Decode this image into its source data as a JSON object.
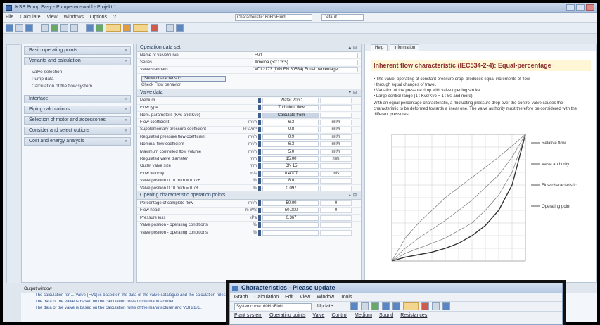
{
  "window": {
    "title": "KSB Pump Easy - Pumpenauswahl - Projekt 1"
  },
  "menu": [
    "File",
    "Calculate",
    "View",
    "Windows",
    "Options",
    "?"
  ],
  "toolbar": {
    "combo1": "Characteristic: 60Hz/Fluid",
    "combo2": "Default"
  },
  "sidebar": {
    "groups": [
      {
        "label": "Basic operating points"
      },
      {
        "label": "Variants and calculation"
      },
      {
        "label": "Interface"
      },
      {
        "label": "Piping calculations"
      },
      {
        "label": "Selection of motor and accessories"
      },
      {
        "label": "Consider and select options"
      },
      {
        "label": "Cost and energy analysis"
      }
    ],
    "subitems": [
      "Valve selection",
      "Pump data",
      "Calculation of the flow system"
    ]
  },
  "center": {
    "section1": "Operation data set",
    "fields1": [
      {
        "label": "Name of valve/curve",
        "value": "FV1"
      },
      {
        "label": "Series",
        "value": "Ameloa (50:1:3:5)"
      },
      {
        "label": "Valve standard",
        "value": "VDI 2173 (DIN EN 60534) Equal percentage"
      }
    ],
    "btn": "Show characteristic",
    "btn_text": "Check Flow behavior",
    "section2": "Valve data",
    "rows": [
      {
        "label": "Medium",
        "unit": "",
        "value": "Water 20°C",
        "extra": ""
      },
      {
        "label": "Flow type",
        "unit": "",
        "value": "Turbulent flow",
        "extra": ""
      },
      {
        "label": "Nom. parameters (Kvs and Kvo)",
        "unit": "",
        "value": "Calculate from",
        "extra": "",
        "hl": true
      },
      {
        "label": "Flow coefficient",
        "unit": "m³/h",
        "value": "6.3",
        "extra": "m³/h"
      },
      {
        "label": "Supplementary pressure coefficient",
        "unit": "kPa/m³",
        "value": "0.8",
        "extra": "m³/h"
      },
      {
        "label": "Regulated pressure flow coefficient",
        "unit": "m³/h",
        "value": "0.9",
        "extra": "m³/h"
      },
      {
        "label": "Nominal flow coefficient",
        "unit": "m³/h",
        "value": "6.3",
        "extra": "m³/h"
      },
      {
        "label": "Maximum controlled flow volume",
        "unit": "m³/h",
        "value": "5.0",
        "extra": "m³/h"
      },
      {
        "label": "Regulated valve diameter",
        "unit": "mm",
        "value": "15.00",
        "extra": "mm"
      },
      {
        "label": "Outlet valve size",
        "unit": "mm",
        "value": "DN 15",
        "extra": ""
      },
      {
        "label": "Flow velocity",
        "unit": "m/s",
        "value": "0.4007",
        "extra": "m/s"
      },
      {
        "label": "Valve position 0.10 m³/h = 0.776",
        "unit": "%",
        "value": "8.0",
        "extra": ""
      },
      {
        "label": "Valve position 0.10 m³/h = 0.78",
        "unit": "%",
        "value": "0.097",
        "extra": ""
      }
    ],
    "section3": "Opening characteristic operation points",
    "rows3": [
      {
        "label": "Percentage of complete flow",
        "unit": "m³/h",
        "value": "50.00",
        "extra": "0"
      },
      {
        "label": "Flow head",
        "unit": "m WS",
        "value": "50.000",
        "extra": "0"
      },
      {
        "label": "Pressure loss",
        "unit": "kPa",
        "value": "0.367",
        "extra": ""
      },
      {
        "label": "Valve position - operating conditions",
        "unit": "%",
        "value": "",
        "extra": ""
      },
      {
        "label": "Valve position - operating conditions",
        "unit": "%",
        "value": "",
        "extra": ""
      }
    ]
  },
  "doc": {
    "tabs": [
      "Help",
      "Information"
    ],
    "title": "Inherent flow characteristic (IEC534-2-4): Equal-percentage",
    "bullets": [
      "• The valve, operating at constant pressure drop, produces equal increments of flow",
      "• through equal changes of travel.",
      "• Variation of the pressure drop with valve opening stroke.",
      "• Large control range (1 : Kvs/Kvo = 1 : 50 and more)."
    ],
    "para": "With an equal-percentage characteristic, a fluctuating pressure drop over the control valve causes the characteristic to be deformed towards a linear one. The valve authority must therefore be considered with the different pressures."
  },
  "chart_data": {
    "type": "line",
    "title": "",
    "xlabel": "",
    "ylabel": "",
    "xlim": [
      0,
      100
    ],
    "ylim": [
      0,
      100
    ],
    "x": [
      0,
      10,
      20,
      30,
      40,
      50,
      60,
      70,
      80,
      90,
      100
    ],
    "series": [
      {
        "values": [
          0,
          3,
          5,
          7,
          10,
          14,
          20,
          28,
          40,
          60,
          100
        ]
      },
      {
        "values": [
          0,
          6,
          10,
          14,
          18,
          24,
          30,
          40,
          52,
          70,
          100
        ]
      },
      {
        "values": [
          0,
          10,
          18,
          25,
          32,
          40,
          48,
          58,
          68,
          82,
          100
        ]
      },
      {
        "values": [
          0,
          18,
          30,
          40,
          50,
          58,
          66,
          74,
          82,
          91,
          100
        ]
      }
    ]
  },
  "legend": [
    "Relative flow",
    "Valve authority",
    "Flow characteristic",
    "Operating point"
  ],
  "status": {
    "head": "Output window",
    "lines": [
      "The calculation for ... Valve (FV1) is based on the data of the valve catalogue and the calculation rules.",
      "The data of the valve is based on the calculation rules of the manufacturer.",
      "The data of the valve is based on the calculation rules of the manufacturer and VDI 2173."
    ]
  },
  "overlay": {
    "title": "Characteristics - Please update",
    "menu": [
      "Graph",
      "Calculation",
      "Edit",
      "View",
      "Window",
      "Tools"
    ],
    "combo": "Systemcurve: 60Hz/Fluid",
    "update": "Update",
    "tabs": [
      "Plant system",
      "Operating points",
      "Valve",
      "Control",
      "Medium",
      "Sound",
      "Resistances"
    ]
  }
}
